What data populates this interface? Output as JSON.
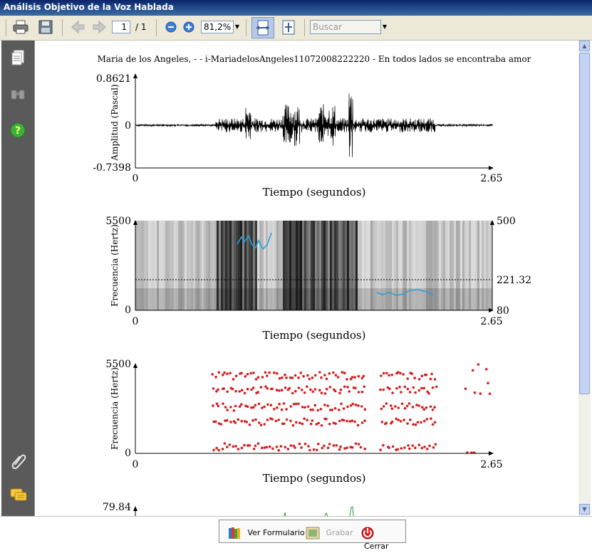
{
  "window": {
    "title": "Análisis Objetivo de la Voz Hablada"
  },
  "toolbar": {
    "icons": [
      "print-icon",
      "save-icon",
      "previous-page-icon",
      "next-page-icon",
      "zoom-out-icon",
      "zoom-in-icon",
      "fit-width-icon",
      "fit-page-icon"
    ],
    "page_current": "1",
    "page_total": "/ 1",
    "zoom": "81,2%",
    "search_placeholder": "Buscar"
  },
  "sidebar": {
    "icons": [
      "pages-icon",
      "binoculars-icon",
      "help-icon",
      "attachment-icon",
      "comments-icon"
    ]
  },
  "document": {
    "title": "Maria de los Angeles, - - i-MariadelosAngeles11072008222220 - En todos lados se encontraba amor",
    "panels": [
      {
        "ylabel": "Amplitud (Pascal)",
        "ymax": "0.8621",
        "ymid": "0",
        "ymin": "-0.7398",
        "xmin": "0",
        "xmax": "2.65",
        "xlabel": "Tiempo (segundos)"
      },
      {
        "ylabel": "Frecuencia (Hertz)",
        "ymax": "5500",
        "ymin": "0",
        "rmax": "500",
        "rmid": "221.32",
        "rmin": "80",
        "xmin": "0",
        "xmax": "2.65",
        "xlabel": "Tiempo (segundos)"
      },
      {
        "ylabel": "Frecuencia (Hertz)",
        "ymax": "5500",
        "ymin": "0",
        "xmin": "0",
        "xmax": "2.65",
        "xlabel": "Tiempo (segundos)"
      },
      {
        "ymax": "79.84"
      }
    ],
    "colors": {
      "pitch": "#2a9fd8",
      "formants": "#d42020",
      "intensity": "#2a9a3a"
    }
  },
  "bottom": {
    "ver_formulario": "Ver Formulario",
    "grabar": "Grabar",
    "cerrar": "Cerrar"
  }
}
